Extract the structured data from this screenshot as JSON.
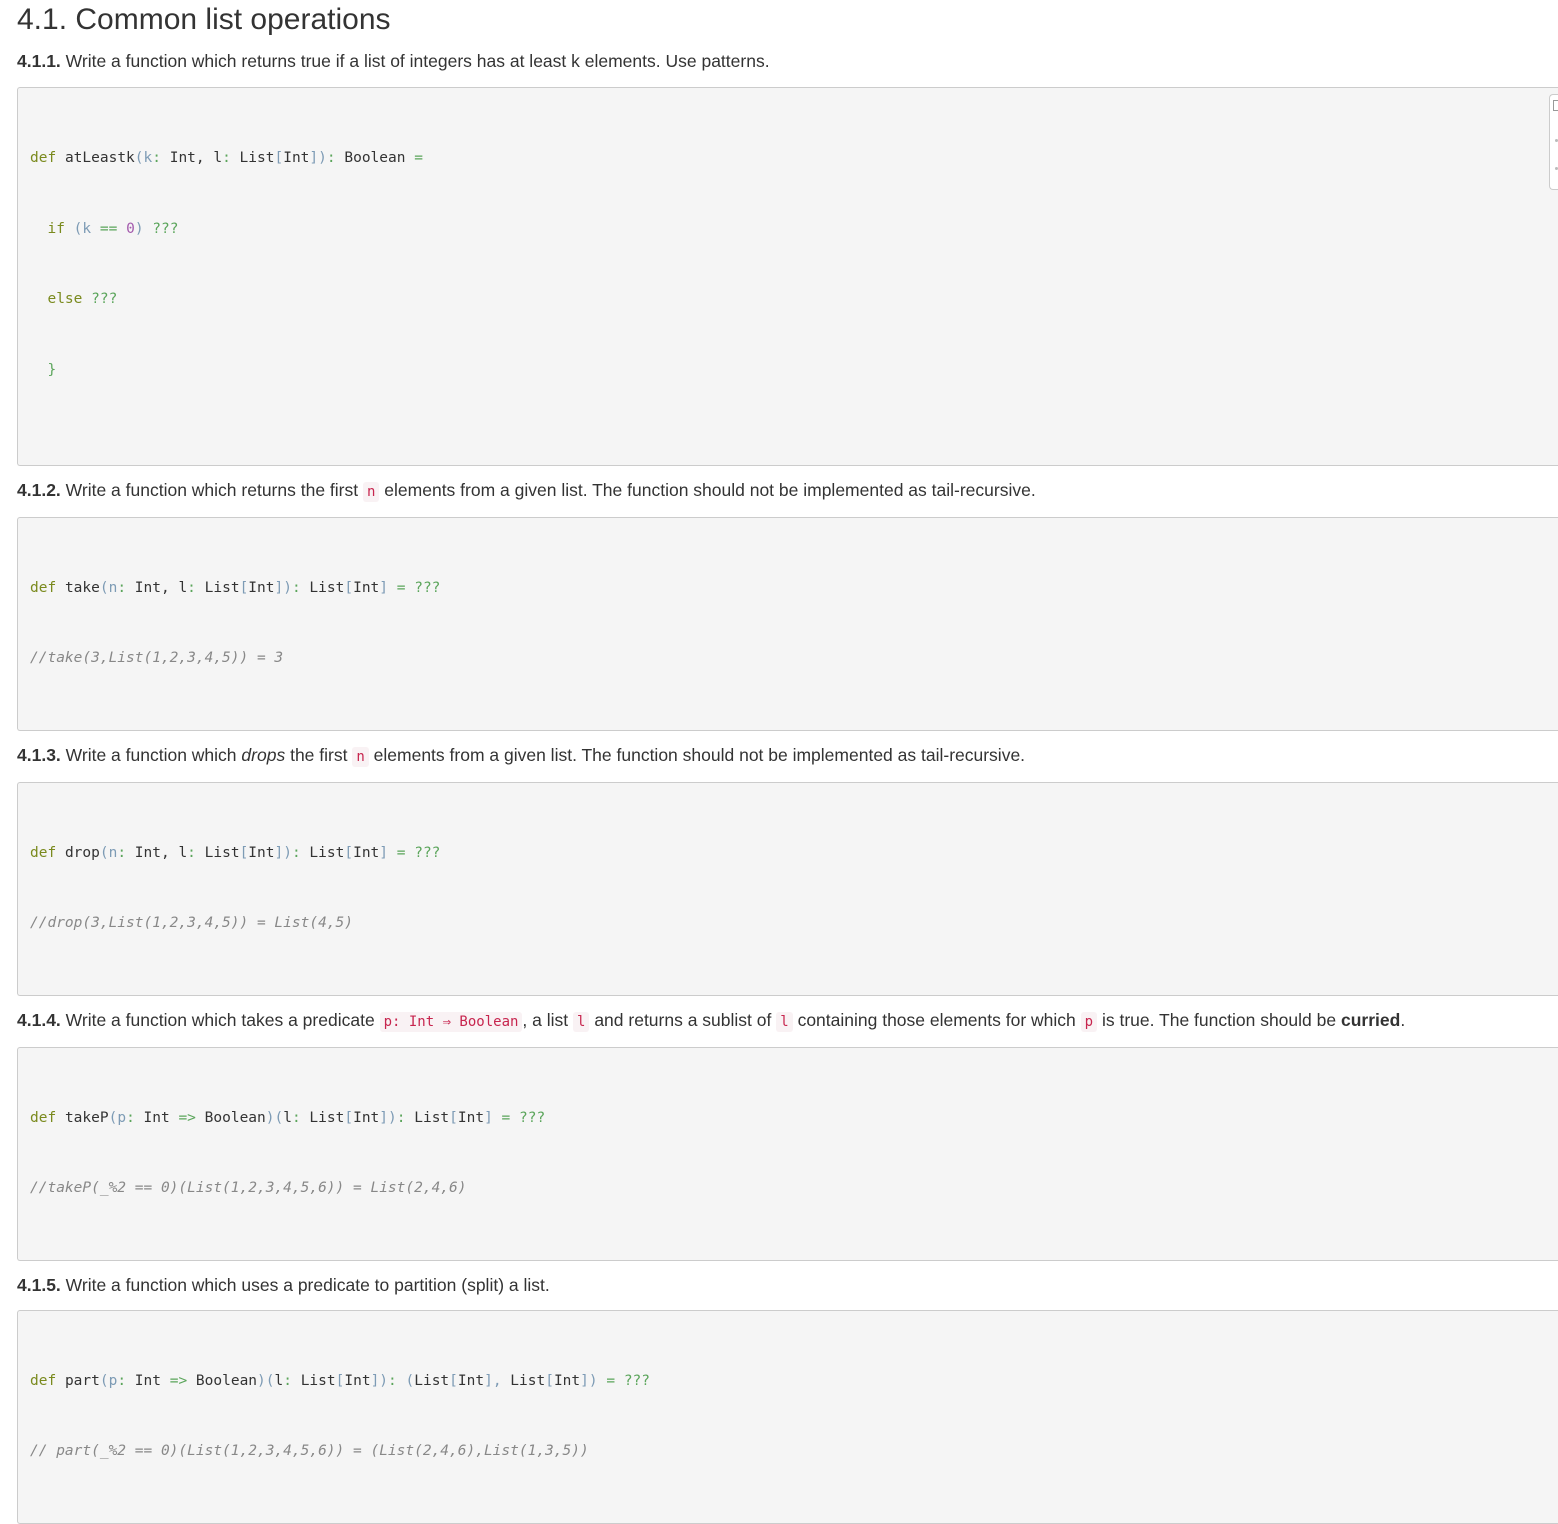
{
  "title": "4.1. Common list operations",
  "exercises": [
    {
      "number": "4.1.1.",
      "text": "Write a function which returns true if a list of integers has at least k elements. Use patterns."
    },
    {
      "number": "4.1.2.",
      "text_before": "Write a function which returns the first",
      "code_n": "n",
      "text_after": "elements from a given list. The function should not be implemented as tail-recursive."
    },
    {
      "number": "4.1.3.",
      "text_a": "Write a function which",
      "text_em": "drops",
      "text_b": "the first",
      "code_n": "n",
      "text_after": "elements from a given list. The function should not be implemented as tail-recursive."
    },
    {
      "number": "4.1.4.",
      "text_a": "Write a function which takes a predicate",
      "code_pred": "p: Int ⇒ Boolean",
      "text_b": ", a list",
      "code_l1": "l",
      "text_c": "and returns a sublist of",
      "code_l2": "l",
      "text_d": "containing those elements for which",
      "code_p": "p",
      "text_e": "is true. The function should be",
      "text_strong": "curried",
      "text_end": "."
    },
    {
      "number": "4.1.5.",
      "text": "Write a function which uses a predicate to partition (split) a list."
    }
  ],
  "code": {
    "c1": {
      "kw_def": "def",
      "name": "atLeastk",
      "p1": "(k",
      "c1": ":",
      "t1": " Int, l",
      "c2": ":",
      "t2": " List",
      "b1": "[",
      "t3": "Int",
      "b2": "])",
      "c3": ":",
      "t4": " Boolean",
      "eq": " =",
      "l2_kw": "if",
      "l2_a": " (k",
      "l2_op": " ==",
      "l2_num": " 0",
      "l2_b": ")",
      "l2_q": " ???",
      "l3_kw": "else",
      "l3_q": " ???",
      "l4": "}"
    },
    "c2": {
      "kw_def": "def",
      "name": "take",
      "p1": "(n",
      "c1": ":",
      "t1": " Int, l",
      "c2": ":",
      "t2": " List",
      "b1": "[",
      "t3": "Int",
      "b2": "])",
      "c3": ":",
      "t4": " List",
      "b3": "[",
      "t5": "Int",
      "b4": "]",
      "eq": " = ???",
      "comment": "//take(3,List(1,2,3,4,5)) = 3"
    },
    "c3": {
      "kw_def": "def",
      "name": "drop",
      "p1": "(n",
      "c1": ":",
      "t1": " Int, l",
      "c2": ":",
      "t2": " List",
      "b1": "[",
      "t3": "Int",
      "b2": "])",
      "c3": ":",
      "t4": " List",
      "b3": "[",
      "t5": "Int",
      "b4": "]",
      "eq": " = ???",
      "comment": "//drop(3,List(1,2,3,4,5)) = List(4,5)"
    },
    "c4": {
      "kw_def": "def",
      "name": "takeP",
      "p1": "(p",
      "c1": ":",
      "t1": " Int",
      "arrow": " =>",
      "t2": " Boolean",
      "b1": ")(",
      "t3": "l",
      "c2": ":",
      "t4": " List",
      "b2": "[",
      "t5": "Int",
      "b3": "])",
      "c3": ":",
      "t6": " List",
      "b4": "[",
      "t7": "Int",
      "b5": "]",
      "eq": " = ???",
      "comment": "//takeP(_%2 == 0)(List(1,2,3,4,5,6)) = List(2,4,6)"
    },
    "c5": {
      "kw_def": "def",
      "name": "part",
      "p1": "(p",
      "c1": ":",
      "t1": " Int",
      "arrow": " =>",
      "t2": " Boolean",
      "b1": ")(",
      "t3": "l",
      "c2": ":",
      "t4": " List",
      "b2": "[",
      "t5": "Int",
      "b3": "])",
      "c3": ":",
      "b4": " (",
      "t6": "List",
      "b5": "[",
      "t7": "Int",
      "b6": "],",
      "t8": " List",
      "b7": "[",
      "t9": "Int",
      "b8": "])",
      "eq": " = ???",
      "comment": "// part(_%2 == 0)(List(1,2,3,4,5,6)) = (List(2,4,6),List(1,3,5))"
    }
  }
}
